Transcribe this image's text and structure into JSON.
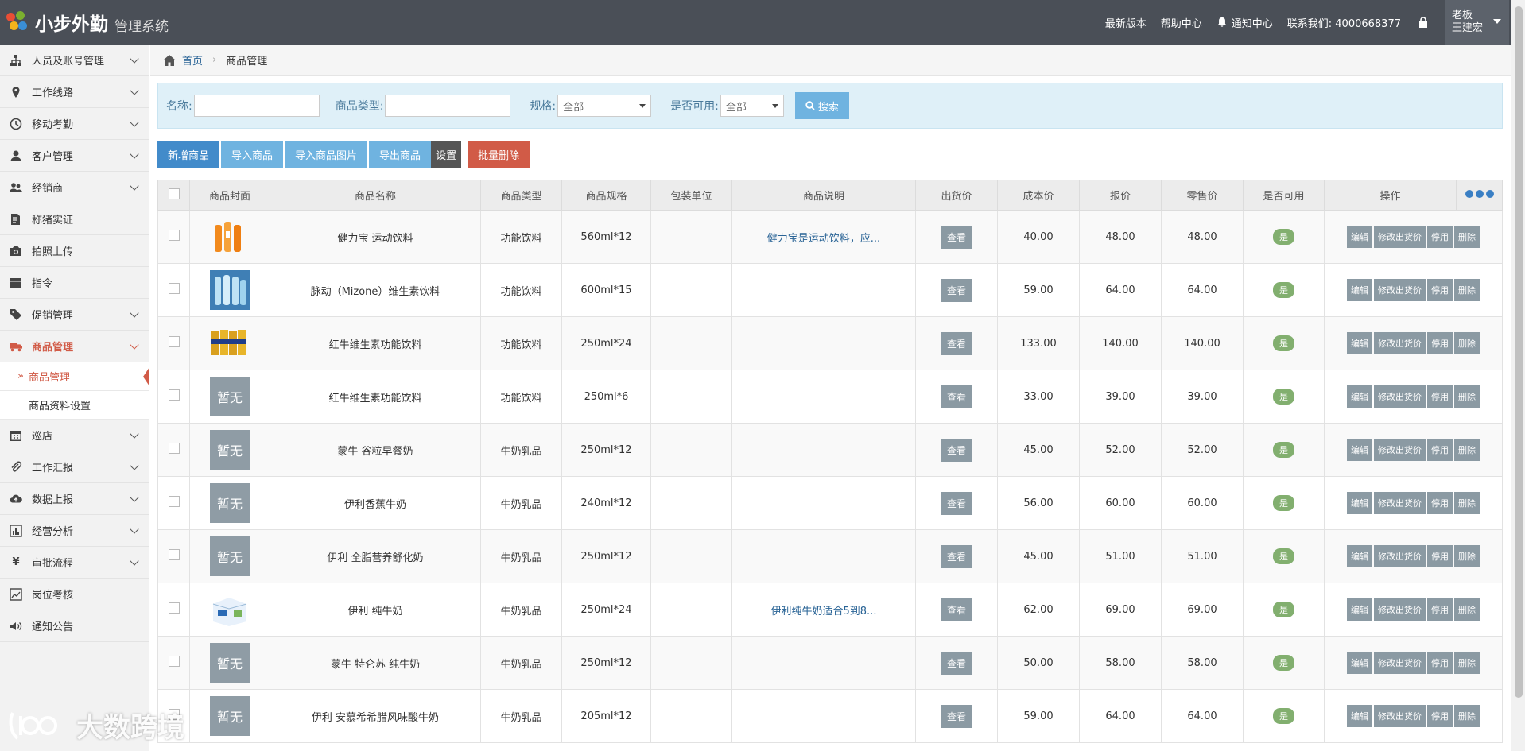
{
  "app": {
    "title": "小步外勤",
    "subtitle": "管理系统"
  },
  "topnav": {
    "latest": "最新版本",
    "help": "帮助中心",
    "notify": "通知中心",
    "contact": "联系我们: 4000668377",
    "user_role": "老板",
    "user_name": "王建宏"
  },
  "sidebar": {
    "items": [
      {
        "label": "人员及账号管理",
        "icon": "org-chart-icon"
      },
      {
        "label": "工作线路",
        "icon": "map-pin-icon"
      },
      {
        "label": "移动考勤",
        "icon": "clock-icon"
      },
      {
        "label": "客户管理",
        "icon": "user-icon"
      },
      {
        "label": "经销商",
        "icon": "users-icon"
      },
      {
        "label": "称猪实证",
        "icon": "document-icon"
      },
      {
        "label": "拍照上传",
        "icon": "camera-icon"
      },
      {
        "label": "指令",
        "icon": "server-icon"
      },
      {
        "label": "促销管理",
        "icon": "tag-icon"
      },
      {
        "label": "商品管理",
        "icon": "truck-icon"
      },
      {
        "label": "巡店",
        "icon": "calendar-icon"
      },
      {
        "label": "工作汇报",
        "icon": "paperclip-icon"
      },
      {
        "label": "数据上报",
        "icon": "cloud-upload-icon"
      },
      {
        "label": "经营分析",
        "icon": "bar-chart-icon"
      },
      {
        "label": "审批流程",
        "icon": "yen-icon"
      },
      {
        "label": "岗位考核",
        "icon": "line-chart-icon"
      },
      {
        "label": "通知公告",
        "icon": "volume-icon"
      }
    ],
    "sub": [
      "商品管理",
      "商品资料设置"
    ]
  },
  "breadcrumb": {
    "home": "首页",
    "current": "商品管理"
  },
  "filter": {
    "name_label": "名称:",
    "type_label": "商品类型:",
    "spec_label": "规格:",
    "spec_value": "全部",
    "avail_label": "是否可用:",
    "avail_value": "全部",
    "search": "搜索"
  },
  "toolbar": {
    "add": "新增商品",
    "import": "导入商品",
    "import_img": "导入商品图片",
    "export": "导出商品",
    "settings": "设置",
    "batch_delete": "批量删除"
  },
  "table": {
    "headers": [
      "商品封面",
      "商品名称",
      "商品类型",
      "商品规格",
      "包装单位",
      "商品说明",
      "出货价",
      "成本价",
      "报价",
      "零售价",
      "是否可用",
      "操作"
    ],
    "view_label": "查看",
    "yes_label": "是",
    "no_cover": "暂无",
    "ops": [
      "编辑",
      "修改出货价",
      "停用",
      "删除"
    ],
    "rows": [
      {
        "cover": "orange-bottles",
        "name": "健力宝 运动饮料",
        "type": "功能饮料",
        "spec": "560ml*12",
        "unit": "",
        "desc": "健力宝是运动饮料，应...",
        "cost": "40.00",
        "quote": "48.00",
        "retail": "48.00"
      },
      {
        "cover": "blue-bottles",
        "name": "脉动（Mizone）维生素饮料",
        "type": "功能饮料",
        "spec": "600ml*15",
        "unit": "",
        "desc": "",
        "cost": "59.00",
        "quote": "64.00",
        "retail": "64.00"
      },
      {
        "cover": "gold-cans",
        "name": "红牛维生素功能饮料",
        "type": "功能饮料",
        "spec": "250ml*24",
        "unit": "",
        "desc": "",
        "cost": "133.00",
        "quote": "140.00",
        "retail": "140.00"
      },
      {
        "cover": "none",
        "name": "红牛维生素功能饮料",
        "type": "功能饮料",
        "spec": "250ml*6",
        "unit": "",
        "desc": "",
        "cost": "33.00",
        "quote": "39.00",
        "retail": "39.00"
      },
      {
        "cover": "none",
        "name": "蒙牛 谷粒早餐奶",
        "type": "牛奶乳品",
        "spec": "250ml*12",
        "unit": "",
        "desc": "",
        "cost": "45.00",
        "quote": "52.00",
        "retail": "52.00"
      },
      {
        "cover": "none",
        "name": "伊利香蕉牛奶",
        "type": "牛奶乳品",
        "spec": "240ml*12",
        "unit": "",
        "desc": "",
        "cost": "56.00",
        "quote": "60.00",
        "retail": "60.00"
      },
      {
        "cover": "none",
        "name": "伊利 全脂营养舒化奶",
        "type": "牛奶乳品",
        "spec": "250ml*12",
        "unit": "",
        "desc": "",
        "cost": "45.00",
        "quote": "51.00",
        "retail": "51.00"
      },
      {
        "cover": "milk-box",
        "name": "伊利 纯牛奶",
        "type": "牛奶乳品",
        "spec": "250ml*24",
        "unit": "",
        "desc": "伊利纯牛奶适合5到8...",
        "cost": "62.00",
        "quote": "69.00",
        "retail": "69.00"
      },
      {
        "cover": "none",
        "name": "蒙牛 特仑苏 纯牛奶",
        "type": "牛奶乳品",
        "spec": "250ml*12",
        "unit": "",
        "desc": "",
        "cost": "50.00",
        "quote": "58.00",
        "retail": "58.00"
      },
      {
        "cover": "none",
        "name": "伊利 安慕希希腊风味酸牛奶",
        "type": "牛奶乳品",
        "spec": "205ml*12",
        "unit": "",
        "desc": "",
        "cost": "59.00",
        "quote": "64.00",
        "retail": "64.00"
      }
    ]
  },
  "watermark": "大数跨境",
  "colors": {
    "topbar": "#4a4f57",
    "accent_red": "#d15b47",
    "primary_blue": "#428bca",
    "light_blue": "#6fb3e0",
    "op_gray": "#8b9aa3",
    "yes_green": "#82af6f"
  }
}
